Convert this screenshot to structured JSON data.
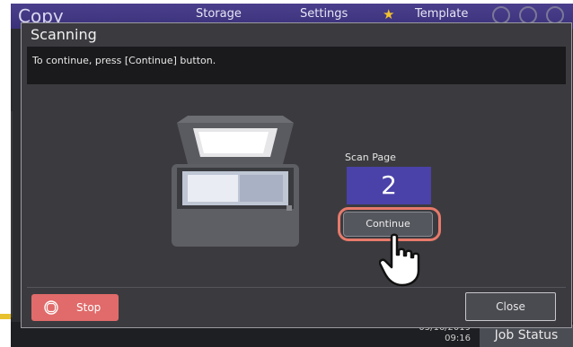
{
  "app": {
    "title": "Copy",
    "tabs": [
      "Storage",
      "Settings",
      "Template"
    ]
  },
  "dialog": {
    "title": "Scanning",
    "message": "To continue, press [Continue] button.",
    "scan_page_label": "Scan Page",
    "scan_page_number": "2",
    "continue_label": "Continue",
    "stop_label": "Stop",
    "close_label": "Close"
  },
  "status_bar": {
    "date": "05/16/2019",
    "time": "09:16",
    "job_status_label": "Job Status"
  },
  "colors": {
    "accent_purple": "#4a42a8",
    "stop_red": "#e06b6a",
    "highlight": "#e87a6b"
  }
}
